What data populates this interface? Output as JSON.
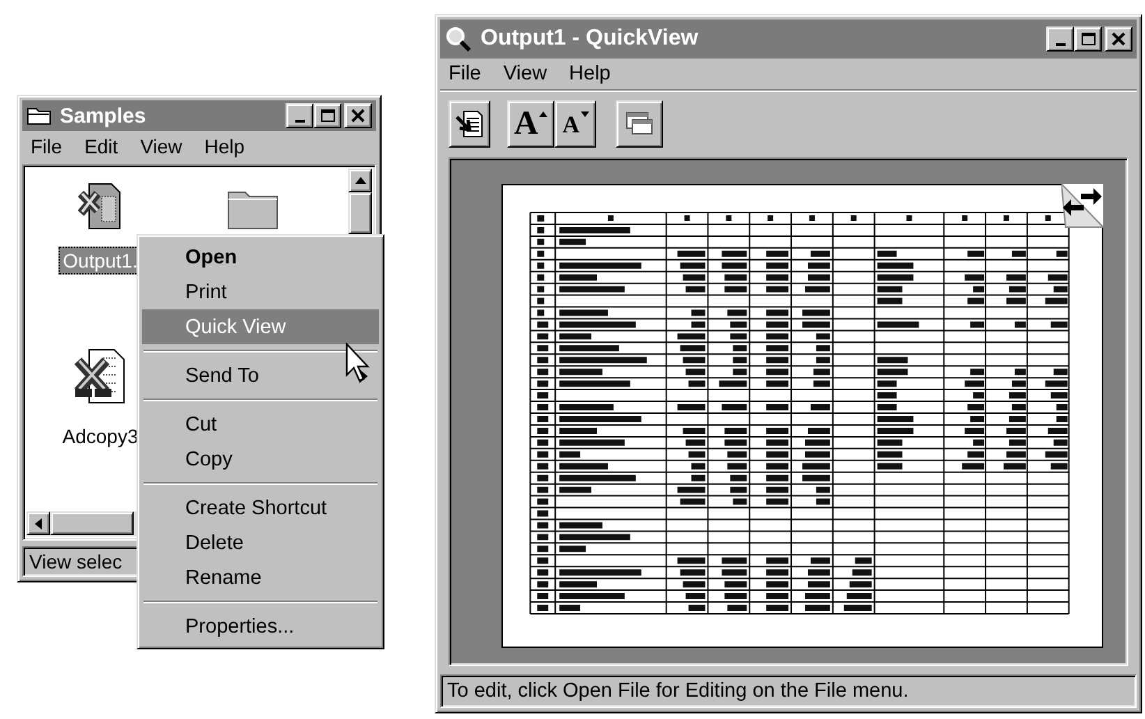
{
  "explorer_window": {
    "title": "Samples",
    "menu": [
      "File",
      "Edit",
      "View",
      "Help"
    ],
    "items": [
      {
        "kind": "sheet",
        "label": "Output1.",
        "selected": true
      },
      {
        "kind": "folder"
      },
      {
        "kind": "document",
        "label": "Adcopy3",
        "selected": false
      }
    ],
    "status": "View selec"
  },
  "context_menu": {
    "items": [
      {
        "kind": "item",
        "label": "Open",
        "default": true,
        "selected": false
      },
      {
        "kind": "item",
        "label": "Print",
        "default": false,
        "selected": false
      },
      {
        "kind": "item",
        "label": "Quick View",
        "default": false,
        "selected": true
      },
      {
        "kind": "separator"
      },
      {
        "kind": "submenu",
        "label": "Send To",
        "default": false,
        "selected": false
      },
      {
        "kind": "separator"
      },
      {
        "kind": "item",
        "label": "Cut",
        "default": false,
        "selected": false
      },
      {
        "kind": "item",
        "label": "Copy",
        "default": false,
        "selected": false
      },
      {
        "kind": "separator"
      },
      {
        "kind": "item",
        "label": "Create Shortcut",
        "default": false,
        "selected": false
      },
      {
        "kind": "item",
        "label": "Delete",
        "default": false,
        "selected": false
      },
      {
        "kind": "item",
        "label": "Rename",
        "default": false,
        "selected": false
      },
      {
        "kind": "separator"
      },
      {
        "kind": "item",
        "label": "Properties...",
        "default": false,
        "selected": false
      }
    ]
  },
  "quickview_window": {
    "title": "Output1 - QuickView",
    "menu": [
      "File",
      "View",
      "Help"
    ],
    "toolbar": [
      {
        "kind": "open-file"
      },
      {
        "kind": "font-larger",
        "glyph": "A"
      },
      {
        "kind": "font-smaller",
        "glyph": "A"
      },
      {
        "kind": "landscape"
      }
    ],
    "preview": {
      "kind": "spreadsheet"
    },
    "status": "To edit, click Open File for Editing on the File menu."
  }
}
